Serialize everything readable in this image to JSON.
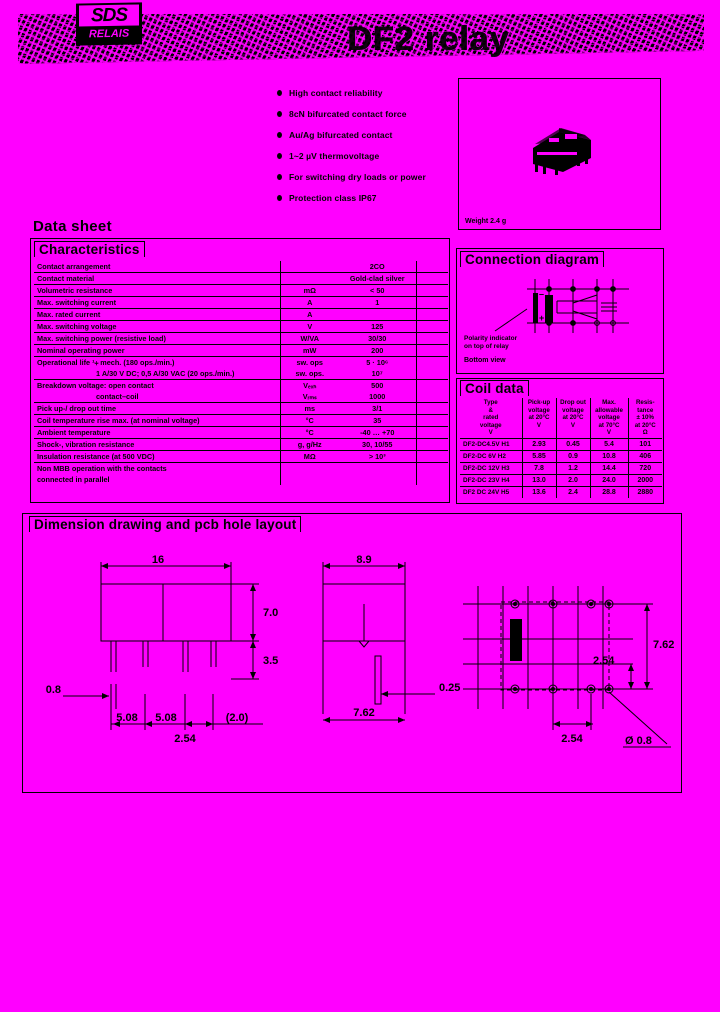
{
  "header": {
    "brand_line1": "SDS",
    "brand_line2": "RELAIS",
    "product_title": "DF2 relay"
  },
  "features": [
    "High contact reliability",
    "8cN bifurcated contact force",
    "Au/Ag bifurcated contact",
    "1~2 µV thermovoltage",
    "For switching dry loads or power",
    "Protection class IP67"
  ],
  "photo": {
    "weight_label": "Weight 2.4 g"
  },
  "datasheet": {
    "title": "Data sheet"
  },
  "characteristics": {
    "title": "Characteristics",
    "rows": [
      {
        "label": "Contact arrangement",
        "unit": "",
        "value": "2CO"
      },
      {
        "label": "Contact material",
        "unit": "",
        "value": "Gold-clad silver"
      },
      {
        "label": "Volumetric resistance",
        "unit": "mΩ",
        "value": "< 50"
      },
      {
        "label": "Max. switching current",
        "unit": "A",
        "value": "1"
      },
      {
        "label": "Max. rated current",
        "unit": "A",
        "value": ""
      },
      {
        "label": "Max. switching voltage",
        "unit": "V",
        "value": "125"
      },
      {
        "label": "Max. switching power (resistive load)",
        "unit": "W/VA",
        "value": "30/30"
      },
      {
        "label": "Nominal operating power",
        "unit": "mW",
        "value": "200"
      },
      {
        "label": "Operational life ¹⧾ mech. (180 ops./min.)",
        "unit": "sw. ops",
        "value": "5 · 10⁶"
      },
      {
        "label": "1 A/30 V DC; 0,5 A/30 VAC (20 ops./min.)",
        "unit": "sw. ops.",
        "value": "10⁷",
        "indent": true
      },
      {
        "label": "Breakdown voltage: open contact",
        "unit": "Vₑₓₕ",
        "value": "500"
      },
      {
        "label": "contact–coil",
        "unit": "Vᵣₘₛ",
        "value": "1000",
        "indent": true
      },
      {
        "label": "Pick up-/ drop out time",
        "unit": "ms",
        "value": "3/1"
      },
      {
        "label": "Coil temperature rise max. (at nominal voltage)",
        "unit": "°C",
        "value": "35"
      },
      {
        "label": "Ambient temperature",
        "unit": "°C",
        "value": "-40 … +70"
      },
      {
        "label": "Shock-, vibration resistance",
        "unit": "g, g/Hz",
        "value": "30, 10/55"
      },
      {
        "label": "Insulation resistance (at 500 VDC)",
        "unit": "MΩ",
        "value": "> 10³"
      },
      {
        "label": "Non MBB operation with the contacts",
        "unit": "",
        "value": ""
      },
      {
        "label": "connected in parallel",
        "unit": "",
        "value": ""
      }
    ]
  },
  "connection_diagram": {
    "title": "Connection diagram",
    "note": "Polarity indicator\non top of relay",
    "note_line1": "Polarity indicator",
    "note_line2": "on top of relay",
    "view_label": "Bottom view"
  },
  "coil_data": {
    "title": "Coil data",
    "columns": [
      {
        "line1": "Type",
        "line2": "&",
        "line3": "rated",
        "line4": "voltage",
        "line5": "V"
      },
      {
        "line1": "Pick-up",
        "line2": "voltage",
        "line3": "at 20°C",
        "line4": "",
        "line5": "V"
      },
      {
        "line1": "Drop out",
        "line2": "voltage",
        "line3": "at 20°C",
        "line4": "",
        "line5": "V"
      },
      {
        "line1": "Max.",
        "line2": "allowable",
        "line3": "voltage",
        "line4": "at 70°C",
        "line5": "V"
      },
      {
        "line1": "Resis-",
        "line2": "tance",
        "line3": "± 10%",
        "line4": "at 20°C",
        "line5": "Ω"
      }
    ],
    "rows": [
      {
        "type": "DF2-DC4.5V H1",
        "pickup": "2.93",
        "dropout": "0.45",
        "maxv": "5.4",
        "res": "101"
      },
      {
        "type": "DF2-DC 6V H2",
        "pickup": "5.85",
        "dropout": "0.9",
        "maxv": "10.8",
        "res": "406"
      },
      {
        "type": "DF2-DC 12V H3",
        "pickup": "7.8",
        "dropout": "1.2",
        "maxv": "14.4",
        "res": "720"
      },
      {
        "type": "DF2-DC 23V H4",
        "pickup": "13.0",
        "dropout": "2.0",
        "maxv": "24.0",
        "res": "2000"
      },
      {
        "type": "DF2 DC 24V H5",
        "pickup": "13.6",
        "dropout": "2.4",
        "maxv": "28.8",
        "res": "2880"
      }
    ]
  },
  "dimension_drawing": {
    "title": "Dimension drawing and pcb hole layout",
    "side_view": {
      "width": "16",
      "body_height": "7.0",
      "pin_length": "3.5",
      "pin_width": "0.8",
      "pitch_1": "5.08",
      "pitch_2": "5.08",
      "edge": "(2.0)",
      "pin_pitch": "2.54"
    },
    "front_view": {
      "width": "8.9",
      "pin_thickness": "0.25",
      "pin_span": "7.62"
    },
    "pcb_layout": {
      "row_span": "7.62",
      "row_pitch": "2.54",
      "hole_pitch": "2.54",
      "hole_dia": "Ø 0.8"
    }
  }
}
